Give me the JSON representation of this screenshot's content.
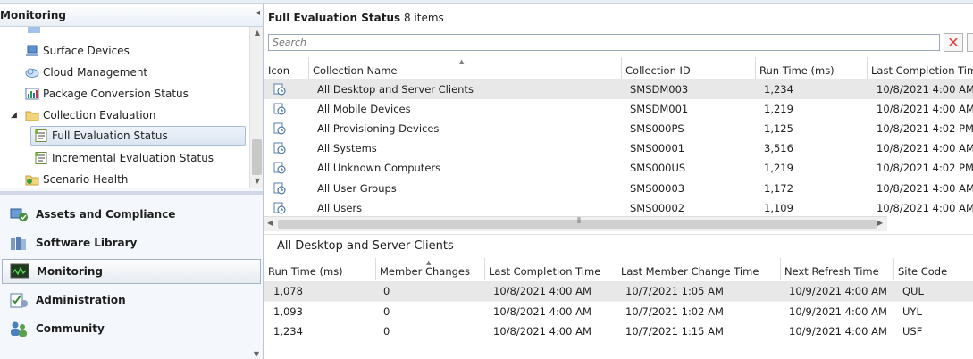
{
  "nav": {
    "title": "Monitoring",
    "collapse_glyph": "◂",
    "tree": [
      {
        "label": "Surface Devices",
        "icon": "surface-devices-icon"
      },
      {
        "label": "Cloud Management",
        "icon": "cloud-icon"
      },
      {
        "label": "Package Conversion Status",
        "icon": "chart-icon"
      },
      {
        "label": "Collection Evaluation",
        "icon": "folder-icon",
        "expanded": true
      },
      {
        "label": "Full Evaluation Status",
        "icon": "report-icon",
        "selected": true
      },
      {
        "label": "Incremental Evaluation Status",
        "icon": "report-icon"
      },
      {
        "label": "Scenario Health",
        "icon": "folder-health-icon"
      }
    ],
    "workspaces": [
      {
        "label": "Assets and Compliance",
        "icon": "assets-compliance-icon"
      },
      {
        "label": "Software Library",
        "icon": "software-library-icon"
      },
      {
        "label": "Monitoring",
        "icon": "monitoring-icon",
        "active": true
      },
      {
        "label": "Administration",
        "icon": "administration-icon"
      },
      {
        "label": "Community",
        "icon": "community-icon"
      }
    ]
  },
  "main": {
    "title": "Full Evaluation Status",
    "count": "8 items",
    "search_placeholder": "Search",
    "columns": [
      "Icon",
      "Collection Name",
      "Collection ID",
      "Run Time (ms)",
      "Last Completion Time"
    ],
    "rows": [
      {
        "name": "All Desktop and Server Clients",
        "id": "SMSDM003",
        "run": "1,234",
        "last": "10/8/2021 4:00 AM",
        "selected": true
      },
      {
        "name": "All Mobile Devices",
        "id": "SMSDM001",
        "run": "1,219",
        "last": "10/8/2021 4:00 AM"
      },
      {
        "name": "All Provisioning Devices",
        "id": "SMS000PS",
        "run": "1,125",
        "last": "10/8/2021 4:02 PM"
      },
      {
        "name": "All Systems",
        "id": "SMS00001",
        "run": "3,516",
        "last": "10/8/2021 4:00 AM"
      },
      {
        "name": "All Unknown Computers",
        "id": "SMS000US",
        "run": "1,219",
        "last": "10/8/2021 4:02 PM"
      },
      {
        "name": "All User Groups",
        "id": "SMS00003",
        "run": "1,172",
        "last": "10/8/2021 4:00 AM"
      },
      {
        "name": "All Users",
        "id": "SMS00002",
        "run": "1,109",
        "last": "10/8/2021 4:00 AM"
      }
    ]
  },
  "detail": {
    "title": "All Desktop and Server Clients",
    "columns": [
      "Run Time (ms)",
      "Member Changes",
      "Last Completion Time",
      "Last Member Change Time",
      "Next Refresh Time",
      "Site Code"
    ],
    "rows": [
      {
        "run": "1,078",
        "changes": "0",
        "last": "10/8/2021 4:00 AM",
        "member": "10/7/2021 1:05 AM",
        "next": "10/9/2021 4:00 AM",
        "site": "QUL",
        "selected": true
      },
      {
        "run": "1,093",
        "changes": "0",
        "last": "10/8/2021 4:00 AM",
        "member": "10/7/2021 1:02 AM",
        "next": "10/9/2021 4:00 AM",
        "site": "UYL"
      },
      {
        "run": "1,234",
        "changes": "0",
        "last": "10/8/2021 4:00 AM",
        "member": "10/7/2021 1:15 AM",
        "next": "10/9/2021 4:00 AM",
        "site": "USF"
      }
    ]
  },
  "colors": {
    "selection": "#e8e8e8",
    "accent": "#3a6fb0",
    "clear": "#e23c3c"
  }
}
